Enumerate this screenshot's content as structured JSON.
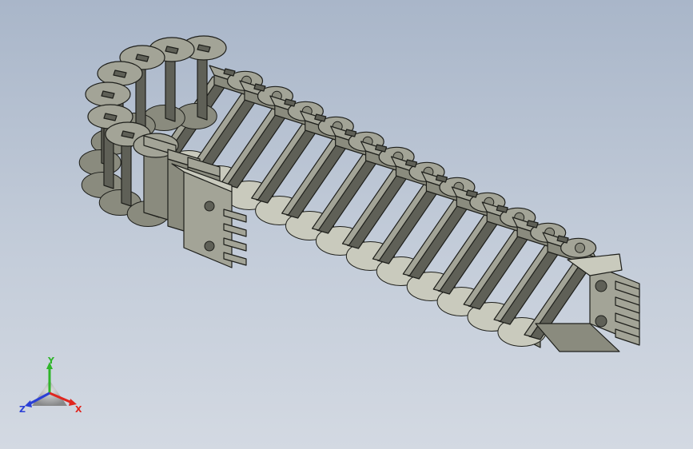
{
  "viewport": {
    "colors": {
      "background_top": "#a9b6c9",
      "background_bottom": "#d3d9e2",
      "part_top": "#a3a497",
      "part_side": "#8a8b7e",
      "part_dark": "#5f6057",
      "part_light": "#c9cabd",
      "edge": "#1e1f1b"
    }
  },
  "model": {
    "name_icon": "cable-drag-chain-model",
    "link_count": 12
  },
  "triad": {
    "x_label": "X",
    "y_label": "Y",
    "z_label": "Z",
    "x_color": "#e0261f",
    "y_color": "#2fb52a",
    "z_color": "#2a3fd6"
  }
}
